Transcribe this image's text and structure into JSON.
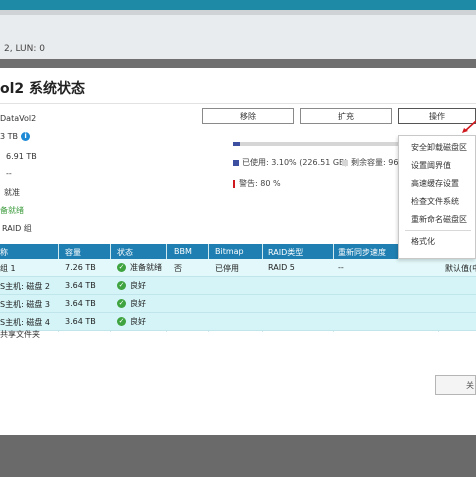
{
  "background": {
    "status_text": "2, LUN: 0"
  },
  "dialog": {
    "title": "ol2 系统状态",
    "info": {
      "volume_name": "DataVol2",
      "capacity": "3 TB",
      "used": "6.91 TB",
      "dash": "--",
      "item4": "就准",
      "status_ready": "备就绪",
      "raid_group": "RAID 组"
    },
    "buttons": {
      "remove": "移除",
      "expand": "扩充",
      "manage": "操作"
    },
    "usage": {
      "used_fraction": 0.031,
      "used_legend": "已使用: 3.10% (226.51 GB)",
      "free_legend": "剩余容量: 96",
      "warning_legend": "警告: 80 %",
      "colors": {
        "used": "#3c4fa0",
        "free": "#d6d6d6",
        "warning": "#d0191f"
      }
    },
    "menu": {
      "items": [
        "安全卸载磁盘区",
        "设置阈界值",
        "高速缓存设置",
        "检查文件系统",
        "重新命名磁盘区"
      ],
      "format": "格式化"
    },
    "table": {
      "headers": [
        "称",
        "容量",
        "状态",
        "BBM",
        "Bitmap",
        "RAID类型",
        "重新同步速度",
        ""
      ],
      "rows": [
        {
          "name": "组 1",
          "capacity": "7.26 TB",
          "status": "准备就绪",
          "bbm": "否",
          "bitmap": "已停用",
          "raid": "RAID 5",
          "resync": "--",
          "extra": "默认值(中"
        },
        {
          "name": "S主机: 磁盘 2",
          "capacity": "3.64 TB",
          "status": "良好"
        },
        {
          "name": "S主机: 磁盘 3",
          "capacity": "3.64 TB",
          "status": "良好"
        },
        {
          "name": "S主机: 磁盘 4",
          "capacity": "3.64 TB",
          "status": "良好"
        }
      ]
    },
    "footnote": "共享文件夹",
    "close_label": "关"
  }
}
